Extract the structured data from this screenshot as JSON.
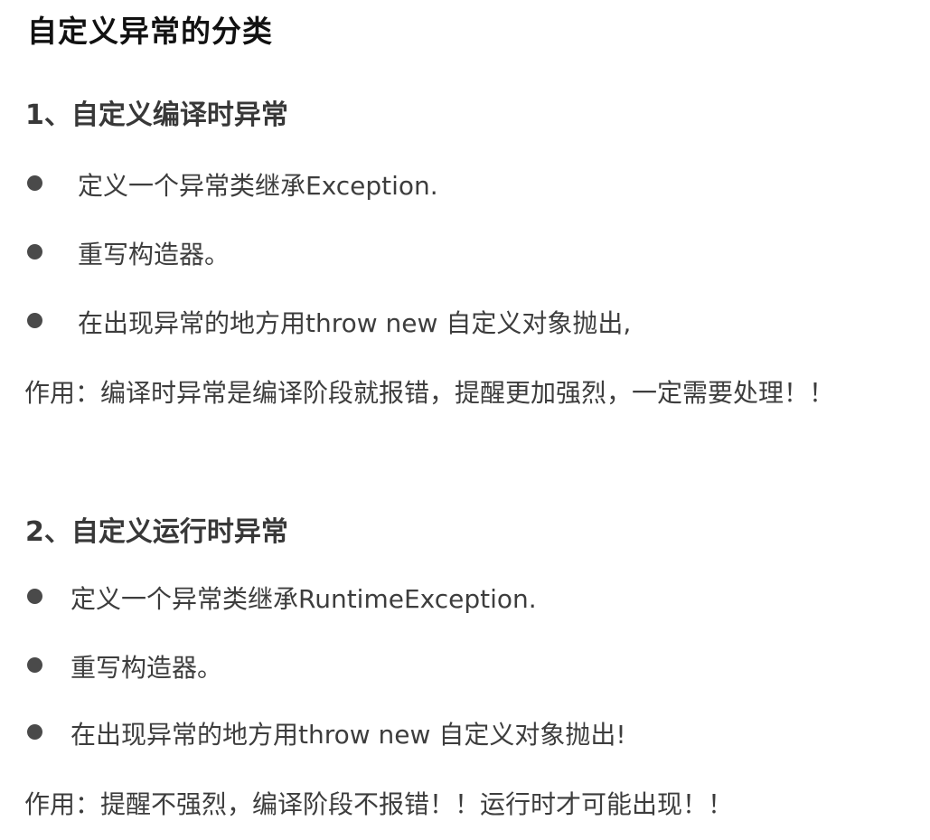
{
  "document": {
    "title": "自定义异常的分类"
  },
  "section1": {
    "heading": "1、自定义编译时异常",
    "bullets": [
      {
        "text": "定义一个异常类继承Exception."
      },
      {
        "text": "重写构造器。"
      },
      {
        "text": "在出现异常的地方用throw new 自定义对象抛出,"
      }
    ],
    "note": "作用：编译时异常是编译阶段就报错，提醒更加强烈，一定需要处理！！"
  },
  "section2": {
    "heading": "2、自定义运行时异常",
    "bullets": [
      {
        "text": "定义一个异常类继承RuntimeException."
      },
      {
        "text": "重写构造器。"
      },
      {
        "text": "在出现异常的地方用throw new 自定义对象抛出!"
      }
    ],
    "note": "作用：提醒不强烈，编译阶段不报错！！运行时才可能出现！！"
  }
}
